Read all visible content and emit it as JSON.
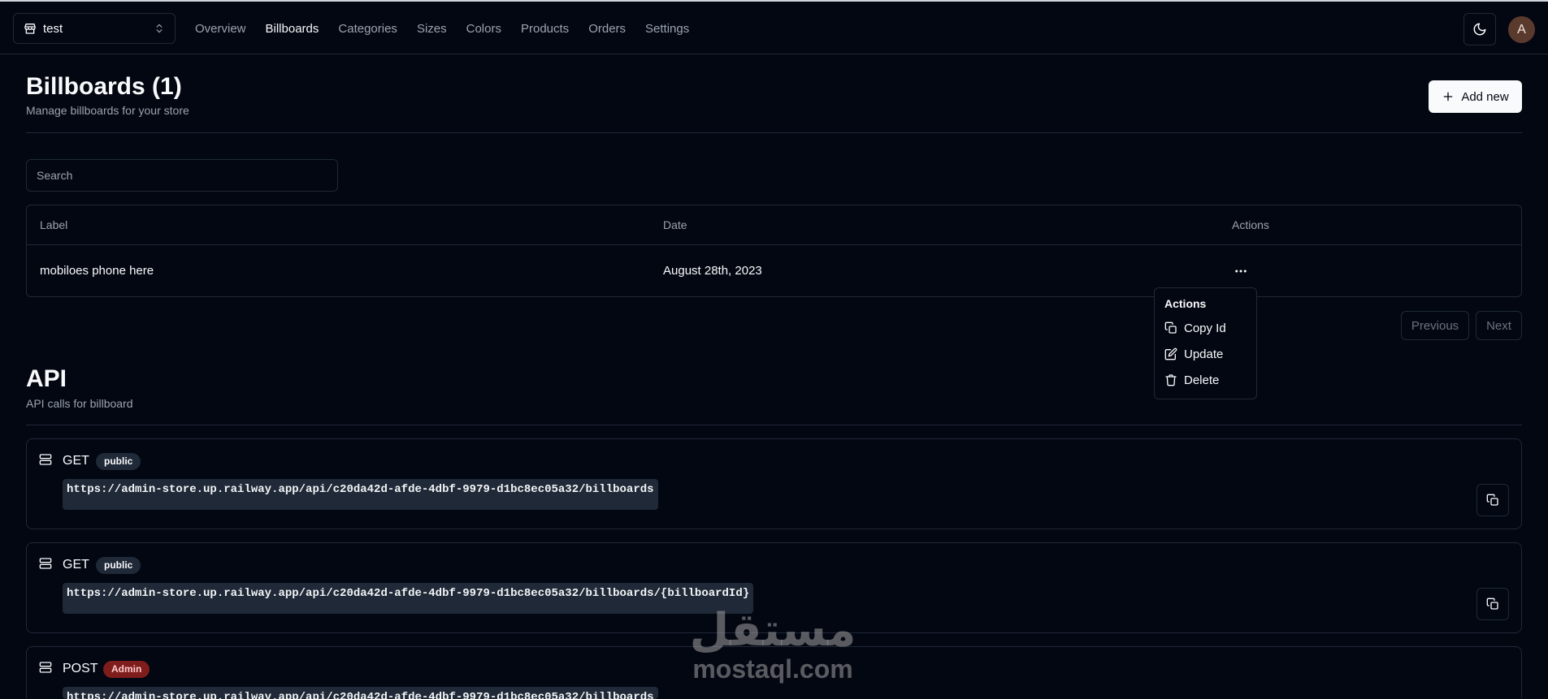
{
  "header": {
    "store_name": "test",
    "nav": [
      {
        "label": "Overview",
        "active": false
      },
      {
        "label": "Billboards",
        "active": true
      },
      {
        "label": "Categories",
        "active": false
      },
      {
        "label": "Sizes",
        "active": false
      },
      {
        "label": "Colors",
        "active": false
      },
      {
        "label": "Products",
        "active": false
      },
      {
        "label": "Orders",
        "active": false
      },
      {
        "label": "Settings",
        "active": false
      }
    ],
    "theme_icon": "moon-icon",
    "avatar_initial": "A"
  },
  "billboards": {
    "title": "Billboards (1)",
    "subtitle": "Manage billboards for your store",
    "add_label": "Add new",
    "search_placeholder": "Search",
    "columns": [
      "Label",
      "Date",
      "Actions"
    ],
    "rows": [
      {
        "label": "mobiloes phone here",
        "date": "August 28th, 2023"
      }
    ],
    "pagination": {
      "previous": "Previous",
      "next": "Next"
    }
  },
  "actions_menu": {
    "label": "Actions",
    "items": [
      {
        "label": "Copy Id",
        "icon": "copy-icon"
      },
      {
        "label": "Update",
        "icon": "edit-icon"
      },
      {
        "label": "Delete",
        "icon": "trash-icon"
      }
    ]
  },
  "api": {
    "title": "API",
    "subtitle": "API calls for billboard",
    "endpoints": [
      {
        "method": "GET",
        "access": "public",
        "url": "https://admin-store.up.railway.app/api/c20da42d-afde-4dbf-9979-d1bc8ec05a32/billboards"
      },
      {
        "method": "GET",
        "access": "public",
        "url": "https://admin-store.up.railway.app/api/c20da42d-afde-4dbf-9979-d1bc8ec05a32/billboards/{billboardId}"
      },
      {
        "method": "POST",
        "access": "Admin",
        "url": "https://admin-store.up.railway.app/api/c20da42d-afde-4dbf-9979-d1bc8ec05a32/billboards"
      }
    ]
  },
  "watermark": {
    "arabic": "مستقل",
    "latin": "mostaql.com"
  },
  "colors": {
    "background": "#030712",
    "border": "#1f2937",
    "admin_badge": "#7f1d1d"
  }
}
